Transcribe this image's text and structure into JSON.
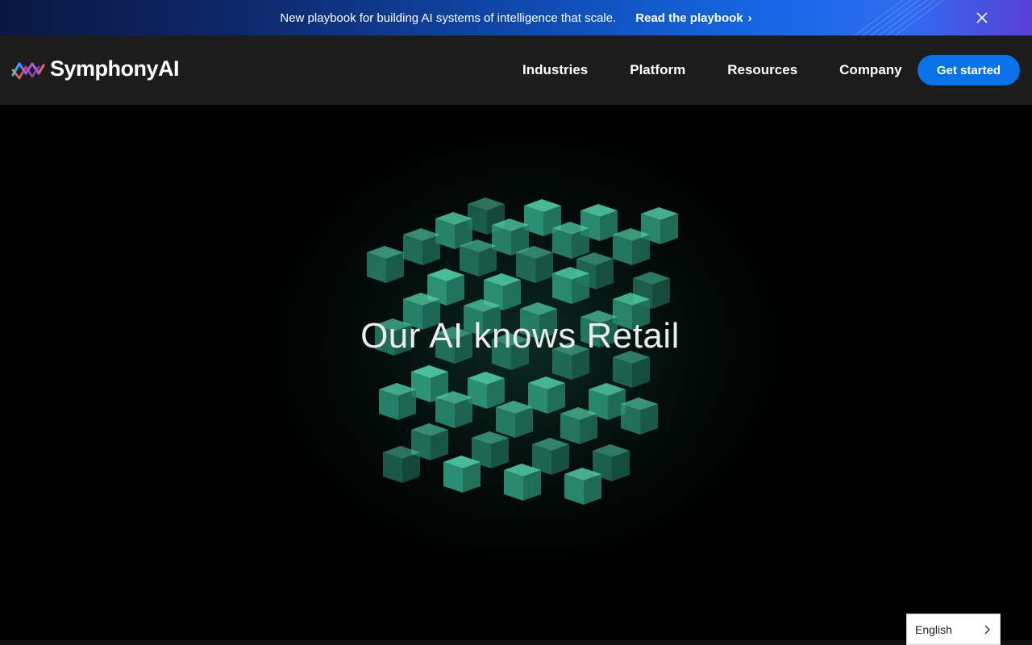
{
  "banner": {
    "text": "New playbook for building AI systems of intelligence that scale.",
    "link_label": "Read the playbook",
    "link_chevron": "›",
    "close_icon": "close-icon"
  },
  "header": {
    "logo_text": "SymphonyAI",
    "nav": [
      {
        "label": "Industries"
      },
      {
        "label": "Platform"
      },
      {
        "label": "Resources"
      },
      {
        "label": "Company"
      }
    ],
    "cta_label": "Get started"
  },
  "hero": {
    "title": "Our AI knows Retail",
    "accent_color": "#2e9a7c"
  },
  "language": {
    "selected": "English"
  },
  "colors": {
    "banner_start": "#0a1640",
    "banner_end": "#5a3fd6",
    "header_bg": "#1c1c1c",
    "cta_bg": "#0a72e8",
    "cube_green": "#2e9a7c"
  }
}
